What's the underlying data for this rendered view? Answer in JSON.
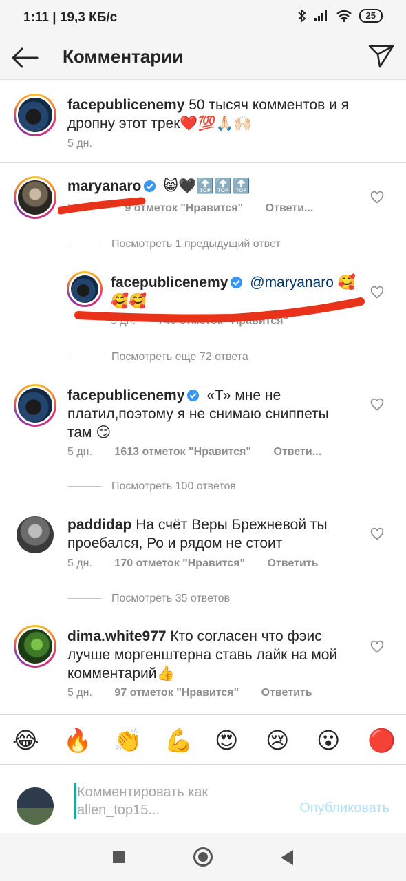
{
  "status_bar": {
    "time_speed": "1:11 | 19,3 КБ/с",
    "battery": "25"
  },
  "header": {
    "title": "Комментарии"
  },
  "comments": [
    {
      "username": "facepublicenemy",
      "text": "50 тысяч комментов и я дропну этот трек❤️💯🙏🏻🙌🏻",
      "time": "5 дн."
    },
    {
      "username": "maryanaro",
      "text": "😸🖤🔝🔝🔝",
      "time": "5",
      "likes": "9 отметок \"Нравится\"",
      "reply": "Ответи..."
    },
    {
      "username": "facepublicenemy",
      "mention": "@maryanaro",
      "text": "🥰🥰🥰",
      "time": "5 дн.",
      "likes": "740 отметок \"Нравится\""
    },
    {
      "username": "facepublicenemy",
      "text": "«Т» мне не платил,поэтому я не снимаю сниппеты там 😏",
      "time": "5 дн.",
      "likes": "1613 отметок \"Нравится\"",
      "reply": "Ответи..."
    },
    {
      "username": "paddidap",
      "text": "На счёт Веры Брежневой ты проебался, Ро и рядом не стоит",
      "time": "5 дн.",
      "likes": "170 отметок \"Нравится\"",
      "reply": "Ответить"
    },
    {
      "username": "dima.white977",
      "text": "Кто согласен что фэис лучше моргенштерна ставь лайк на мой комментарий👍",
      "time": "5 дн.",
      "likes": "97 отметок \"Нравится\"",
      "reply": "Ответить"
    }
  ],
  "view_replies": [
    "Посмотреть 1 предыдущий ответ",
    "Посмотреть еще 72 ответа",
    "Посмотреть 100 ответов",
    "Посмотреть 35 ответов"
  ],
  "emoji_bar": [
    "😂",
    "🔥",
    "👏",
    "💪",
    "😍",
    "😢",
    "😮",
    "🔴"
  ],
  "composer": {
    "placeholder": "Комментировать как allen_top15...",
    "publish": "Опубликовать"
  },
  "icons": {
    "back": "arrow-left-icon",
    "send": "paper-plane-icon",
    "heart": "heart-outline-icon",
    "verified": "verified-badge-icon"
  },
  "colors": {
    "verified": "#3897f0",
    "redaction": "#e8321a",
    "publish": "#b2dffc",
    "mention": "#00376b"
  }
}
